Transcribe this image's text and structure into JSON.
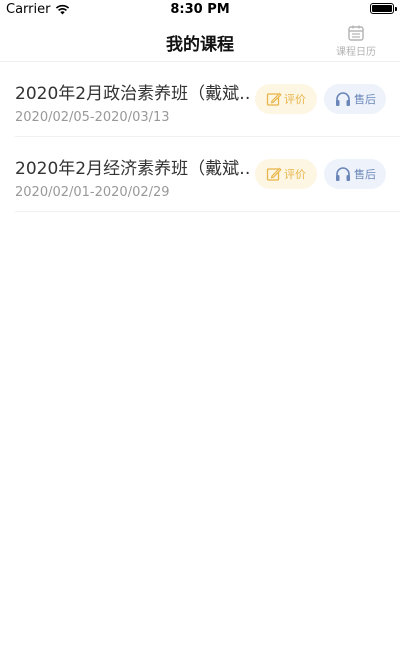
{
  "status_bar": {
    "carrier": "Carrier",
    "time": "8:30 PM"
  },
  "nav": {
    "title": "我的课程",
    "calendar_label": "课程日历"
  },
  "courses": [
    {
      "title": "2020年2月政治素养班（戴斌…",
      "date_range": "2020/02/05-2020/03/13",
      "review_label": "评价",
      "service_label": "售后"
    },
    {
      "title": "2020年2月经济素养班（戴斌…",
      "date_range": "2020/02/01-2020/02/29",
      "review_label": "评价",
      "service_label": "售后"
    }
  ],
  "colors": {
    "review": "#e8b54a",
    "service": "#6a86b8",
    "review_bg": "#fdf6e3",
    "service_bg": "#eef3fb"
  },
  "icons": {
    "review": "edit-icon",
    "service": "headphones-icon",
    "calendar": "calendar-icon"
  }
}
